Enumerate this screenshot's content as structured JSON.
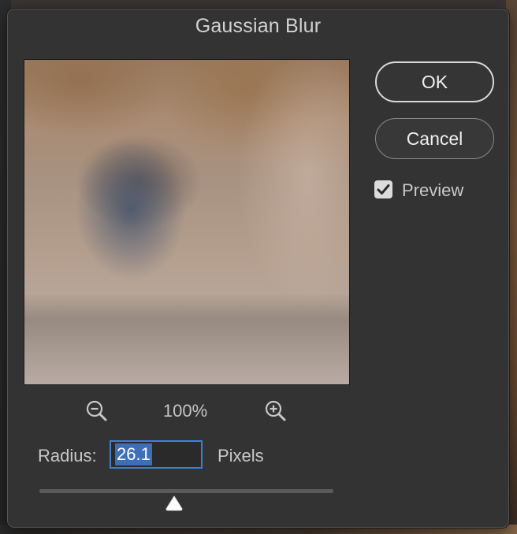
{
  "dialog": {
    "title": "Gaussian Blur"
  },
  "buttons": {
    "ok_label": "OK",
    "cancel_label": "Cancel"
  },
  "preview": {
    "label": "Preview",
    "checked": true
  },
  "zoom": {
    "level": "100%",
    "zoom_out_icon": "zoom-out-icon",
    "zoom_in_icon": "zoom-in-icon"
  },
  "radius": {
    "label": "Radius:",
    "value": "26.1",
    "units": "Pixels",
    "slider_position": 0.46
  },
  "colors": {
    "dialog_bg": "#333333",
    "input_focus_border": "#3e7fd6",
    "selection": "#3d6fb8",
    "text": "#c9c9c9"
  }
}
